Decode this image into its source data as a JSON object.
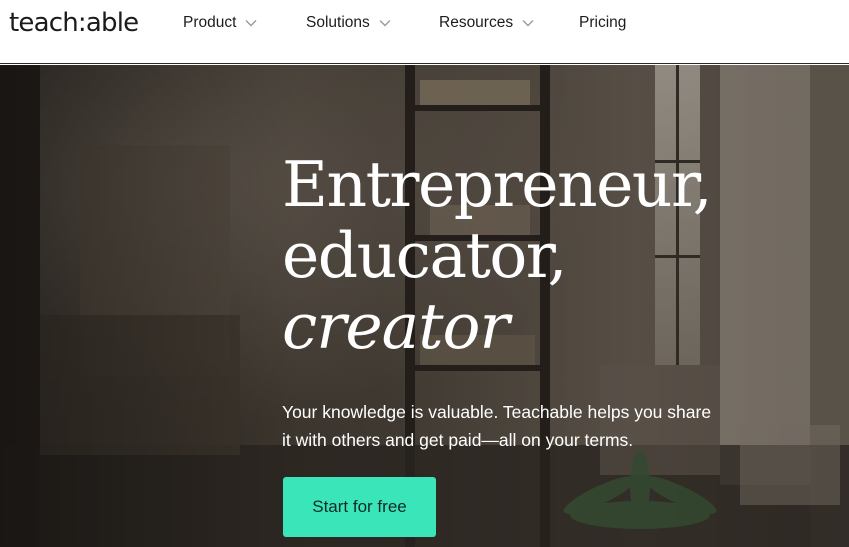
{
  "brand": {
    "logo_text": "teach:able"
  },
  "nav": {
    "items": [
      {
        "label": "Product",
        "has_dropdown": true
      },
      {
        "label": "Solutions",
        "has_dropdown": true
      },
      {
        "label": "Resources",
        "has_dropdown": true
      },
      {
        "label": "Pricing",
        "has_dropdown": false
      }
    ]
  },
  "hero": {
    "headline_line1": "Entrepreneur,",
    "headline_line2": "educator,",
    "headline_line3": "creator",
    "subtext_line1": "Your knowledge is valuable. Teachable helps you share",
    "subtext_line2": "it with others and get paid—all on your terms.",
    "cta_label": "Start for free"
  },
  "colors": {
    "accent": "#3ae6b9",
    "nav_text": "#1d1d1d",
    "hero_text": "#ffffff"
  }
}
